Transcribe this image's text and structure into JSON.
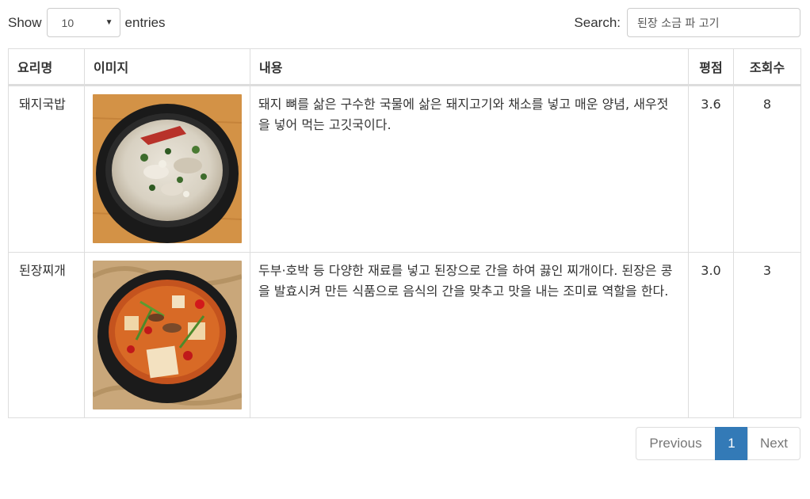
{
  "length": {
    "prefix": "Show",
    "selected": "10",
    "suffix": "entries"
  },
  "filter": {
    "label": "Search:",
    "value": "된장 소금 파 고기"
  },
  "table": {
    "headers": [
      "요리명",
      "이미지",
      "내용",
      "평점",
      "조회수"
    ],
    "rows": [
      {
        "name": "돼지국밥",
        "image": "pork-soup-photo",
        "description": "돼지 뼈를 삶은 구수한 국물에 삶은 돼지고기와 채소를 넣고 매운 양념, 새우젓을 넣어 먹는 고깃국이다.",
        "rating": "3.6",
        "views": "8"
      },
      {
        "name": "된장찌개",
        "image": "soybean-stew-photo",
        "description": "두부·호박 등 다양한 재료를 넣고 된장으로 간을 하여 끓인 찌개이다. 된장은 콩을 발효시켜 만든 식품으로 음식의 간을 맞추고 맛을 내는 조미료 역할을 한다.",
        "rating": "3.0",
        "views": "3"
      }
    ]
  },
  "pagination": {
    "previous": "Previous",
    "current": "1",
    "next": "Next"
  },
  "colors": {
    "accent": "#337ab7",
    "border": "#dddddd",
    "text": "#333333"
  }
}
